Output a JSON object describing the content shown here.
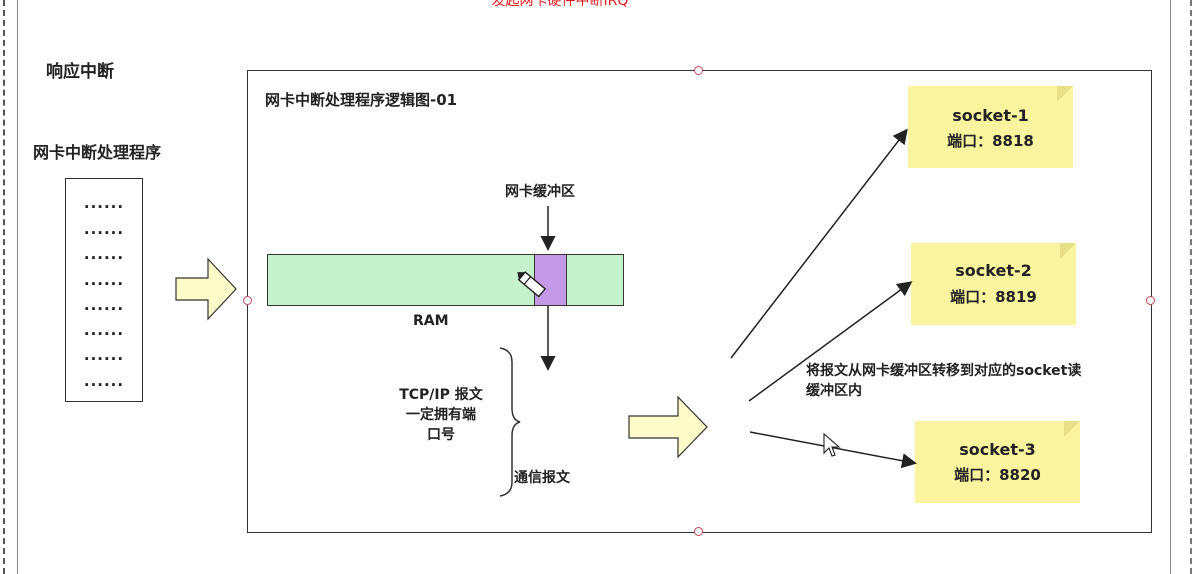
{
  "top_caption": "发起网卡硬件中断IRQ",
  "section_title": "响应中断",
  "handler_label": "网卡中断处理程序",
  "code_lines": [
    "······",
    "······",
    "······",
    "······",
    "······",
    "······",
    "······",
    "······"
  ],
  "frame_title": "网卡中断处理程序逻辑图-01",
  "nic_buffer_label": "网卡缓冲区",
  "ram_label": "RAM",
  "tcp_note": [
    "TCP/IP 报文",
    "一定拥有端",
    "口号"
  ],
  "comm_label": "通信报文",
  "transfer_note": [
    "将报文从网卡缓冲区转移到对应的socket读",
    "缓冲区内"
  ],
  "sockets": [
    {
      "name": "socket-1",
      "port": "端口：8818"
    },
    {
      "name": "socket-2",
      "port": "端口：8819"
    },
    {
      "name": "socket-3",
      "port": "端口：8820"
    }
  ],
  "colors": {
    "ram_fill": "#c5f1cc",
    "buffer_slot": "#c49ae8",
    "note_fill": "#fbf49e",
    "block_arrow_fill": "#fdfcc8",
    "caption_red": "#e21b1b"
  }
}
